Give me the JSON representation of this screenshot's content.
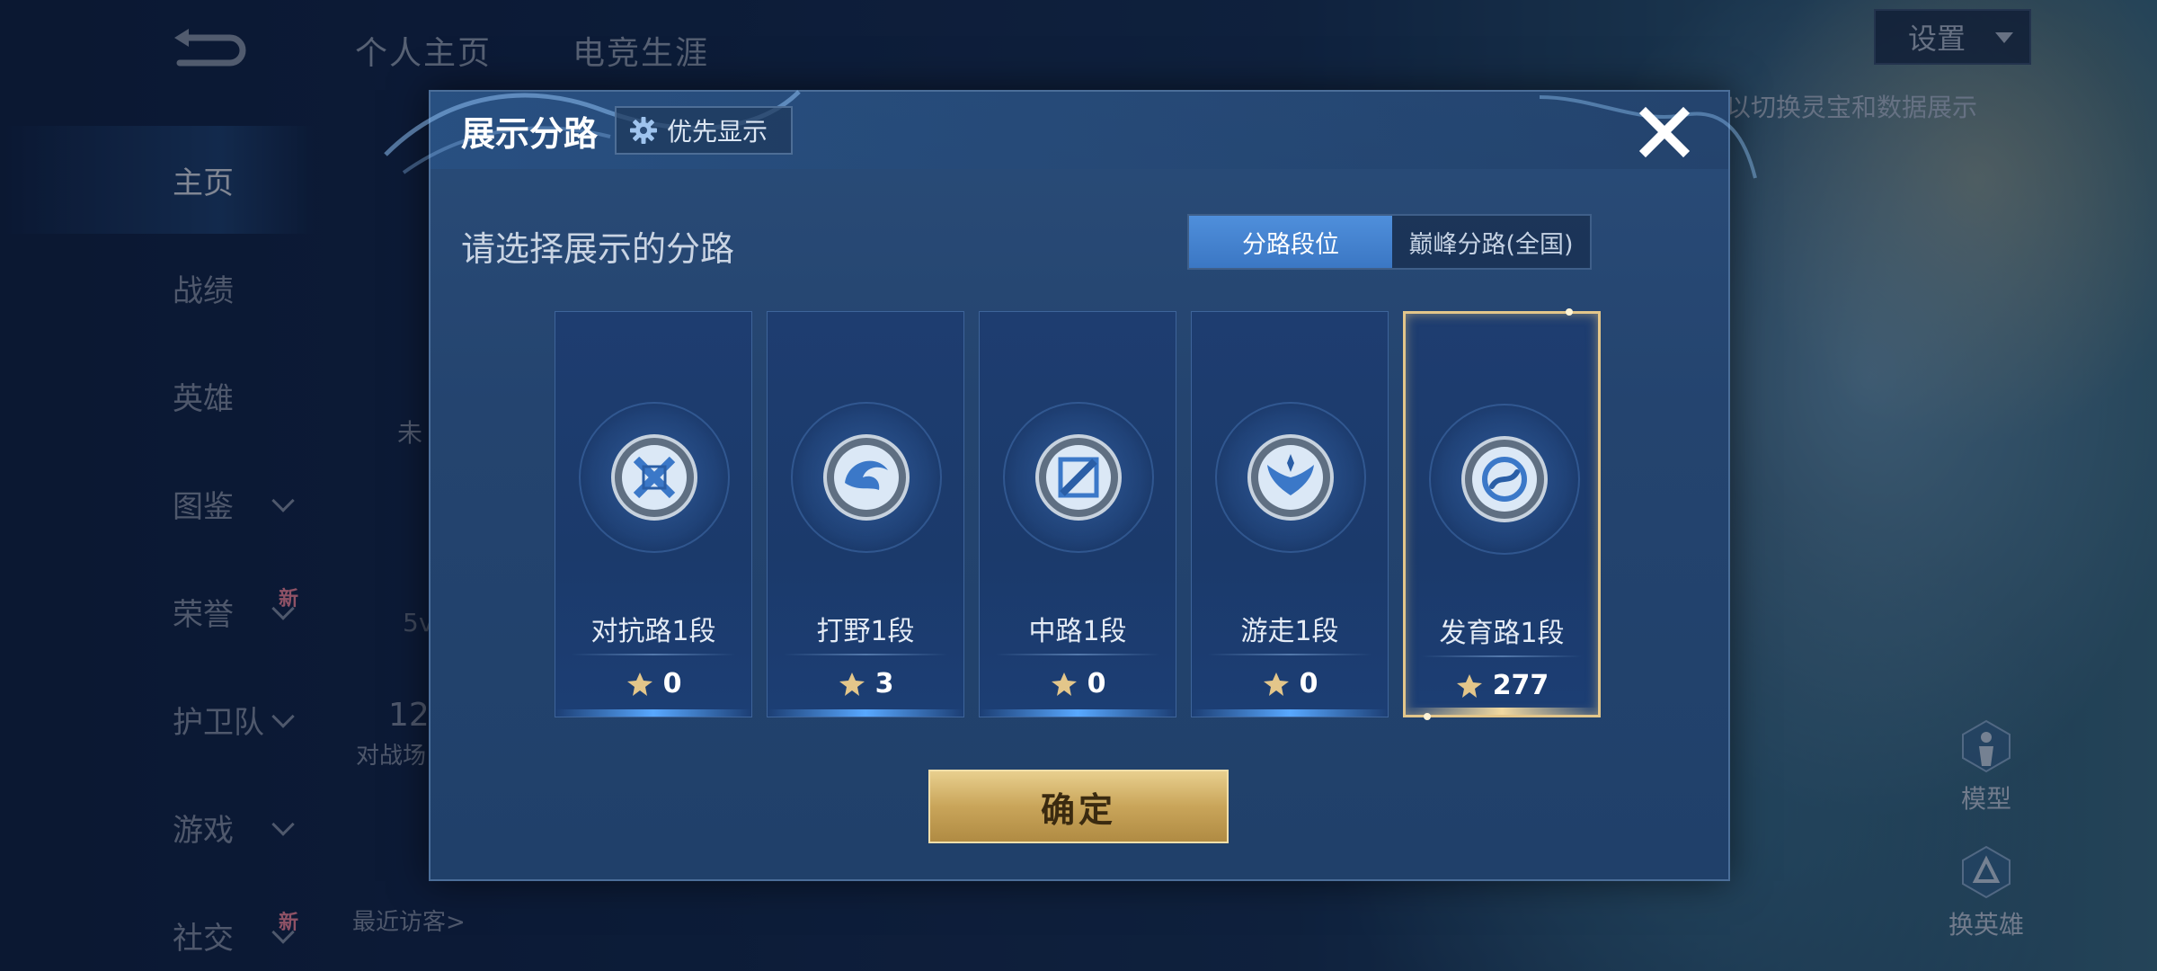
{
  "background": {
    "top_tabs": [
      "个人主页",
      "电竞生涯"
    ],
    "sidebar": [
      {
        "label": "主页",
        "active": true,
        "chevron": false,
        "badge": ""
      },
      {
        "label": "战绩",
        "active": false,
        "chevron": false,
        "badge": ""
      },
      {
        "label": "英雄",
        "active": false,
        "chevron": false,
        "badge": ""
      },
      {
        "label": "图鉴",
        "active": false,
        "chevron": true,
        "badge": ""
      },
      {
        "label": "荣誉",
        "active": false,
        "chevron": true,
        "badge": "新"
      },
      {
        "label": "护卫队",
        "active": false,
        "chevron": true,
        "badge": ""
      },
      {
        "label": "游戏",
        "active": false,
        "chevron": true,
        "badge": ""
      },
      {
        "label": "社交",
        "active": false,
        "chevron": true,
        "badge": "新"
      }
    ],
    "settings_label": "设置",
    "hint_text": "以切换灵宝和数据展示",
    "recent_visitors": "最近访客>",
    "partial_number": "12",
    "partial_label": "对战场",
    "partial_5v": "5v",
    "partial_wei": "未",
    "widgets": [
      "模型",
      "换英雄"
    ]
  },
  "modal": {
    "title": "展示分路",
    "priority_label": "优先显示",
    "subtitle": "请选择展示的分路",
    "segment_tabs": [
      "分路段位",
      "巅峰分路(全国)"
    ],
    "active_segment": 0,
    "lanes": [
      {
        "name": "对抗路1段",
        "score": "0",
        "icon": "sword-shield-icon",
        "selected": false
      },
      {
        "name": "打野1段",
        "score": "3",
        "icon": "dragon-icon",
        "selected": false
      },
      {
        "name": "中路1段",
        "score": "0",
        "icon": "staff-icon",
        "selected": false
      },
      {
        "name": "游走1段",
        "score": "0",
        "icon": "wings-icon",
        "selected": false
      },
      {
        "name": "发育路1段",
        "score": "277",
        "icon": "bow-icon",
        "selected": true
      }
    ],
    "confirm_label": "确定"
  },
  "colors": {
    "modal_bg": "#24446f",
    "accent_blue": "#4f8fdb",
    "gold": "#e3c68a"
  }
}
